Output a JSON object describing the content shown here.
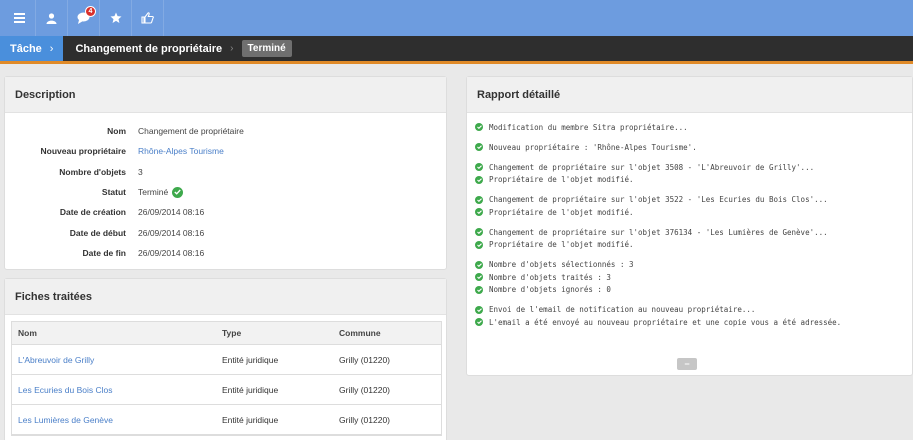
{
  "nav": {
    "menu_icon": "hamburger-icon",
    "user_icon": "user-icon",
    "notifications_icon": "chat-bubble-icon",
    "notifications_count": "4",
    "favorites_icon": "star-icon",
    "share_icon": "thumbs-up-icon",
    "bg_color": "#6d9cdf"
  },
  "breadcrumb": {
    "root": "Tâche",
    "separator": "›",
    "title": "Changement de propriétaire",
    "arrow": "›",
    "status": "Terminé"
  },
  "description": {
    "heading": "Description",
    "rows": [
      {
        "label": "Nom",
        "value": "Changement de propriétaire"
      },
      {
        "label": "Nouveau propriétaire",
        "value": "Rhône-Alpes Tourisme"
      },
      {
        "label": "Nombre d'objets",
        "value": "3"
      },
      {
        "label": "Statut",
        "value": "Terminé"
      },
      {
        "label": "Date de création",
        "value": "26/09/2014 08:16"
      },
      {
        "label": "Date de début",
        "value": "26/09/2014 08:16"
      },
      {
        "label": "Date de fin",
        "value": "26/09/2014 08:16"
      }
    ]
  },
  "fiches": {
    "heading": "Fiches traitées",
    "columns": [
      "Nom",
      "Type",
      "Commune"
    ],
    "rows": [
      {
        "nom": "L'Abreuvoir de Grilly",
        "type": "Entité juridique",
        "commune": "Grilly (01220)"
      },
      {
        "nom": "Les Ecuries du Bois Clos",
        "type": "Entité juridique",
        "commune": "Grilly (01220)"
      },
      {
        "nom": "Les Lumières de Genève",
        "type": "Entité juridique",
        "commune": "Grilly (01220)"
      }
    ]
  },
  "rapport": {
    "heading": "Rapport détaillé",
    "lines": [
      "Modification du membre Sitra propriétaire...",
      "",
      "Nouveau propriétaire : 'Rhône-Alpes Tourisme'.",
      "",
      "Changement de propriétaire sur l'objet 3508 - 'L'Abreuvoir de Grilly'...",
      "Propriétaire de l'objet modifié.",
      "",
      "Changement de propriétaire sur l'objet 3522 - 'Les Ecuries du Bois Clos'...",
      "Propriétaire de l'objet modifié.",
      "",
      "Changement de propriétaire sur l'objet 376134 - 'Les  Lumières de Genève'...",
      "Propriétaire de l'objet modifié.",
      "",
      "Nombre d'objets sélectionnés : 3",
      "Nombre d'objets traités : 3",
      "Nombre d'objets ignorés : 0",
      "",
      "Envoi de l'email de notification au nouveau propriétaire...",
      "L'email a été envoyé au nouveau propriétaire et une copie vous a été adressée."
    ],
    "collapse_label": "−"
  },
  "colors": {
    "accent": "#4a8fdc",
    "success": "#3ea94c",
    "link": "#4a7fc8",
    "header_dark": "#2e2e2e",
    "orange_line": "#e08a28"
  }
}
